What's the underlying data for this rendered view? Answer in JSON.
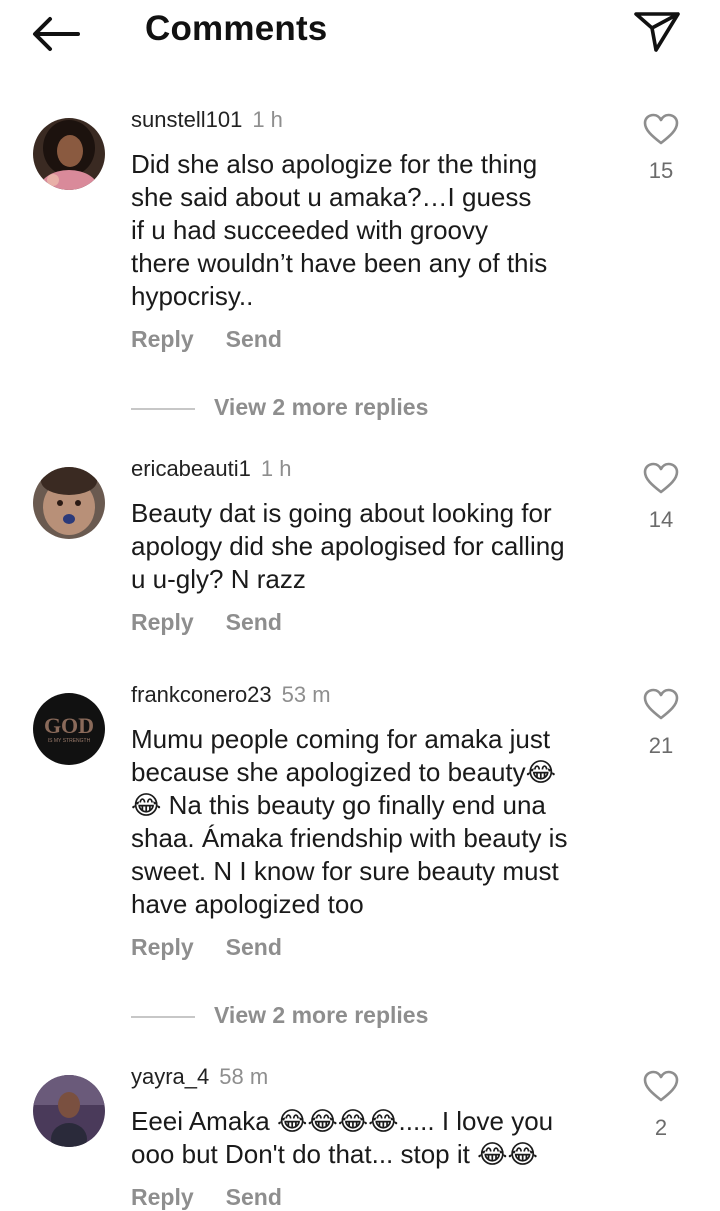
{
  "header": {
    "title": "Comments",
    "back_icon": "arrow-left-icon",
    "send_icon": "paper-plane-icon"
  },
  "comments": [
    {
      "username": "sunstell101",
      "time": "1 h",
      "lines": [
        "Did she also apologize for the thing",
        "she said about u amaka?…I guess",
        "if u had succeeded with groovy",
        "there wouldn’t have been any of this",
        "hypocrisy.."
      ],
      "likes": "15",
      "reply_label": "Reply",
      "send_label": "Send",
      "view_replies": "View 2 more replies"
    },
    {
      "username": "ericabeauti1",
      "time": "1 h",
      "lines": [
        "Beauty dat is going about looking for",
        "apology did she apologised for calling",
        "u u-gly? N razz"
      ],
      "likes": "14",
      "reply_label": "Reply",
      "send_label": "Send"
    },
    {
      "username": "frankconero23",
      "time": "53 m",
      "avatar_text": "GOD",
      "avatar_subtext": "IS MY STRENGTH",
      "lines": [
        "Mumu people coming for amaka just",
        "because she apologized to beauty😂",
        "😂 Na this beauty go finally end una",
        "shaa. Ámaka friendship with beauty is",
        "sweet. N I know for sure beauty must",
        "have apologized too"
      ],
      "likes": "21",
      "reply_label": "Reply",
      "send_label": "Send",
      "view_replies": "View 2 more replies"
    },
    {
      "username": "yayra_4",
      "time": "58 m",
      "lines": [
        "Eeei Amaka 😂😂😂😂..... I love you",
        "ooo but Don't do that... stop it 😂😂"
      ],
      "likes": "2",
      "reply_label": "Reply",
      "send_label": "Send"
    }
  ],
  "colors": {
    "text": "#1a1a1a",
    "secondary": "#8e8e8e",
    "divider": "#c7c7c7",
    "background": "#ffffff"
  }
}
